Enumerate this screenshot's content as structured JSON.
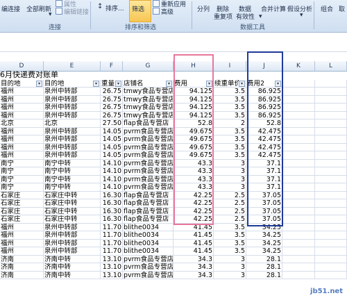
{
  "ribbon": {
    "buttons": {
      "edit_links_partial": "编连接",
      "refresh_all": "全部刷新",
      "properties": "属性",
      "edit_links": "编辑链接",
      "sort": "排序...",
      "filter": "筛选",
      "reapply": "重新应用",
      "advanced": "高级",
      "text_to_columns": "分列",
      "remove_duplicates_1": "删除",
      "remove_duplicates_2": "重复项",
      "data_validation_1": "数据",
      "data_validation_2": "有效性",
      "consolidate": "合并计算",
      "what_if": "假设分析",
      "group": "组合",
      "ungroup": "取"
    },
    "groups": {
      "connections": "连接",
      "sort_filter": "排序和筛选",
      "data_tools": "数据工具"
    }
  },
  "columns": [
    "D",
    "E",
    "F",
    "G",
    "H",
    "I",
    "J",
    "K",
    "L"
  ],
  "title": "6月快递费对账单",
  "headers": {
    "d": "目的地",
    "e": "目的地",
    "f": "重量",
    "g": "店铺名",
    "h": "费用",
    "i": "续重单价",
    "j": "费用2"
  },
  "rows": [
    {
      "d": "福州",
      "e": "泉州中转部",
      "f": "26.75",
      "g": "tmwy食品专营店",
      "h": "94.125",
      "i": "3.5",
      "j": "86.925"
    },
    {
      "d": "福州",
      "e": "泉州中转部",
      "f": "26.75",
      "g": "tmwy食品专营店",
      "h": "94.125",
      "i": "3.5",
      "j": "86.925"
    },
    {
      "d": "福州",
      "e": "泉州中转部",
      "f": "26.75",
      "g": "tmwy食品专营店",
      "h": "94.125",
      "i": "3.5",
      "j": "86.925"
    },
    {
      "d": "福州",
      "e": "泉州中转部",
      "f": "26.75",
      "g": "tmwy食品专营店",
      "h": "94.125",
      "i": "3.5",
      "j": "86.925"
    },
    {
      "d": "北京",
      "e": "北京",
      "f": "27.50",
      "g": "flap食品专营店",
      "h": "52.8",
      "i": "2",
      "j": "52.8"
    },
    {
      "d": "福州",
      "e": "泉州中转部",
      "f": "14.05",
      "g": "pvrm食品专营店",
      "h": "49.675",
      "i": "3.5",
      "j": "42.475"
    },
    {
      "d": "福州",
      "e": "泉州中转部",
      "f": "14.05",
      "g": "pvrm食品专营店",
      "h": "49.675",
      "i": "3.5",
      "j": "42.475"
    },
    {
      "d": "福州",
      "e": "泉州中转部",
      "f": "14.05",
      "g": "pvrm食品专营店",
      "h": "49.675",
      "i": "3.5",
      "j": "42.475"
    },
    {
      "d": "福州",
      "e": "泉州中转部",
      "f": "14.05",
      "g": "pvrm食品专营店",
      "h": "49.675",
      "i": "3.5",
      "j": "42.475"
    },
    {
      "d": "南宁",
      "e": "南宁中转",
      "f": "14.10",
      "g": "pvrm食品专营店",
      "h": "43.3",
      "i": "3",
      "j": "37.1"
    },
    {
      "d": "南宁",
      "e": "南宁中转",
      "f": "14.10",
      "g": "pvrm食品专营店",
      "h": "43.3",
      "i": "3",
      "j": "37.1"
    },
    {
      "d": "南宁",
      "e": "南宁中转",
      "f": "14.10",
      "g": "pvrm食品专营店",
      "h": "43.3",
      "i": "3",
      "j": "37.1"
    },
    {
      "d": "南宁",
      "e": "南宁中转",
      "f": "14.10",
      "g": "pvrm食品专营店",
      "h": "43.3",
      "i": "3",
      "j": "37.1"
    },
    {
      "d": "石家庄",
      "e": "石家庄中转",
      "f": "16.30",
      "g": "flap食品专营店",
      "h": "42.25",
      "i": "2.5",
      "j": "37.05"
    },
    {
      "d": "石家庄",
      "e": "石家庄中转",
      "f": "16.30",
      "g": "flap食品专营店",
      "h": "42.25",
      "i": "2.5",
      "j": "37.05"
    },
    {
      "d": "石家庄",
      "e": "石家庄中转",
      "f": "16.30",
      "g": "flap食品专营店",
      "h": "42.25",
      "i": "2.5",
      "j": "37.05"
    },
    {
      "d": "石家庄",
      "e": "石家庄中转",
      "f": "16.30",
      "g": "flap食品专营店",
      "h": "42.25",
      "i": "2.5",
      "j": "37.05"
    },
    {
      "d": "福州",
      "e": "泉州中转部",
      "f": "11.70",
      "g": "blithe0034",
      "h": "41.45",
      "i": "3.5",
      "j": "34.25"
    },
    {
      "d": "福州",
      "e": "泉州中转部",
      "f": "11.70",
      "g": "blithe0034",
      "h": "41.45",
      "i": "3.5",
      "j": "34.25"
    },
    {
      "d": "福州",
      "e": "泉州中转部",
      "f": "11.70",
      "g": "blithe0034",
      "h": "41.45",
      "i": "3.5",
      "j": "34.25"
    },
    {
      "d": "福州",
      "e": "泉州中转部",
      "f": "11.70",
      "g": "blithe0034",
      "h": "41.45",
      "i": "3.5",
      "j": "34.25"
    },
    {
      "d": "济南",
      "e": "济南中转",
      "f": "13.10",
      "g": "pvrm食品专营店",
      "h": "34.3",
      "i": "3",
      "j": "28.1"
    },
    {
      "d": "济南",
      "e": "济南中转",
      "f": "13.10",
      "g": "pvrm食品专营店",
      "h": "34.3",
      "i": "3",
      "j": "28.1"
    },
    {
      "d": "济南",
      "e": "济南中转",
      "f": "13.10",
      "g": "pvrm食品专营店",
      "h": "34.3",
      "i": "3",
      "j": "28.1"
    }
  ],
  "watermark": "jb51.net",
  "colors": {
    "pink_box": "#e8779c",
    "blue_box": "#1f3a9a",
    "header_bg": "#dde7f4"
  }
}
